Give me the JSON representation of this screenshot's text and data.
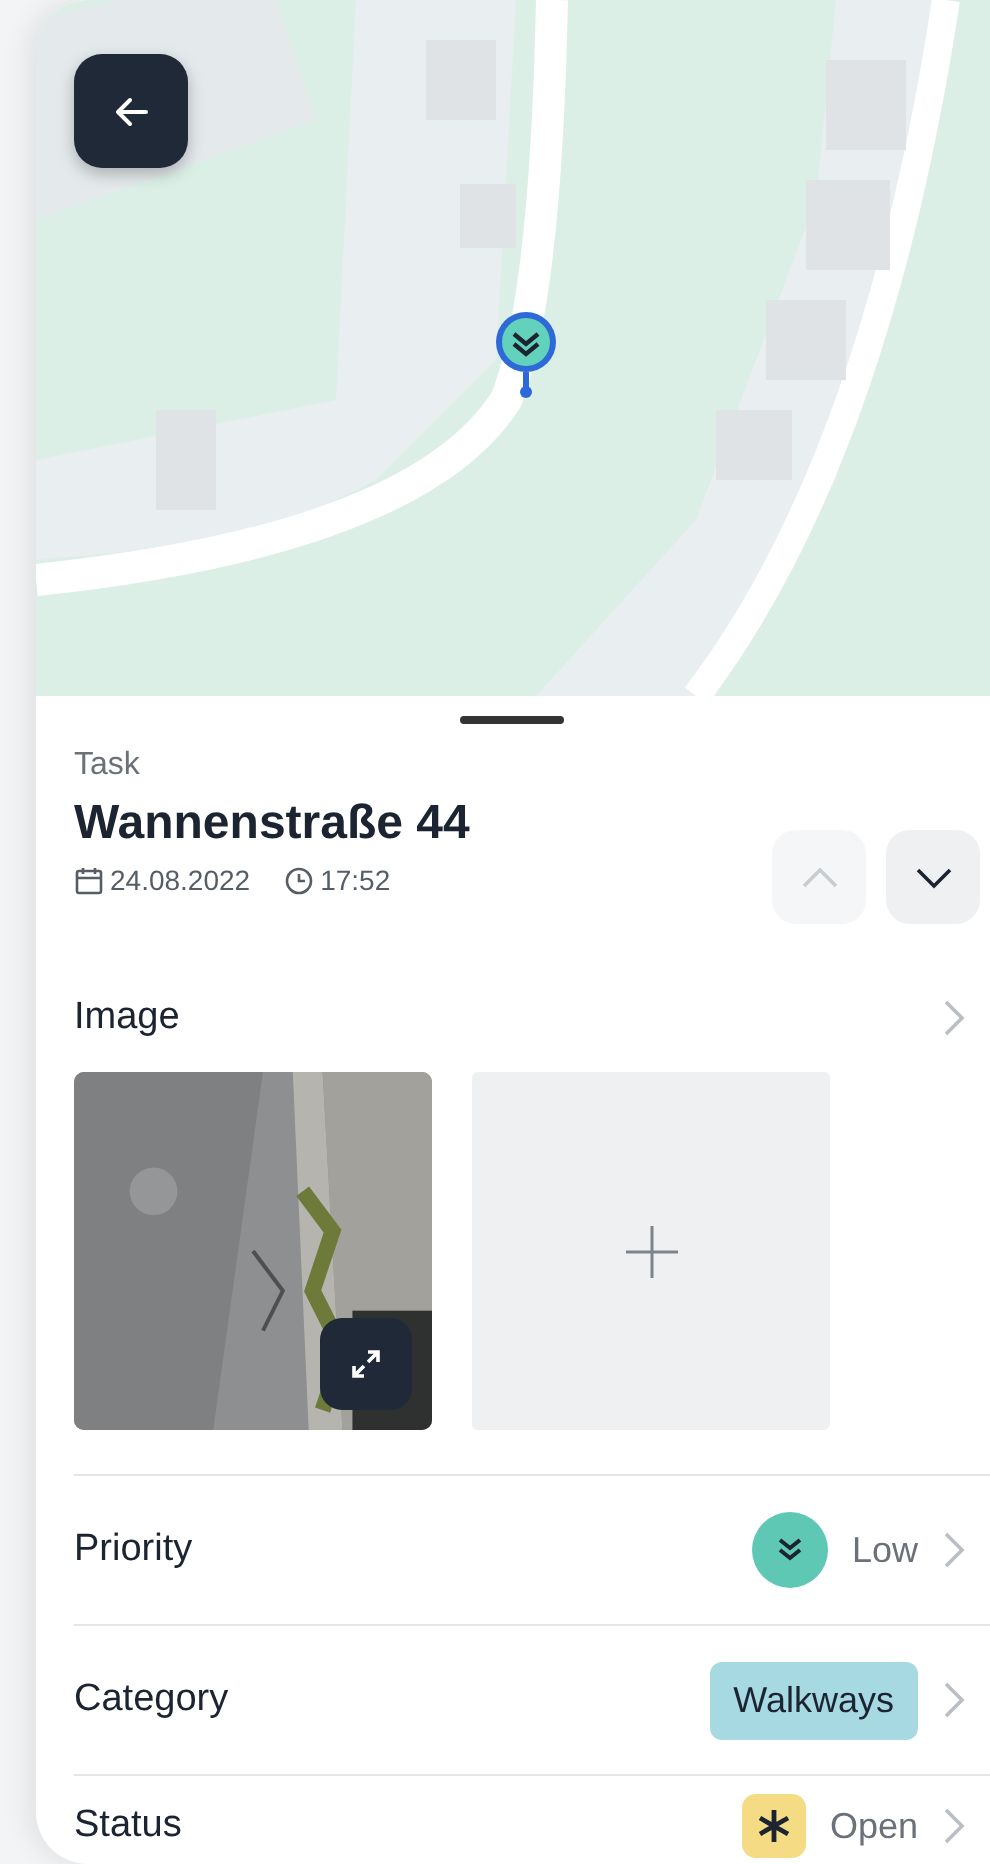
{
  "header": {
    "label": "Task",
    "title": "Wannenstraße 44",
    "date": "24.08.2022",
    "time": "17:52"
  },
  "nav": [
    {
      "kind": "up",
      "disabled": true
    },
    {
      "kind": "down",
      "disabled": false
    }
  ],
  "image_section": {
    "title": "Image"
  },
  "rows": [
    {
      "kind": "priority",
      "label": "Priority",
      "value": "Low",
      "color": "#5ec8b4"
    },
    {
      "kind": "category",
      "label": "Category",
      "value": "Walkways",
      "color": "#a6d9e2"
    },
    {
      "kind": "status",
      "label": "Status",
      "value": "Open",
      "color": "#f5dc84"
    }
  ]
}
